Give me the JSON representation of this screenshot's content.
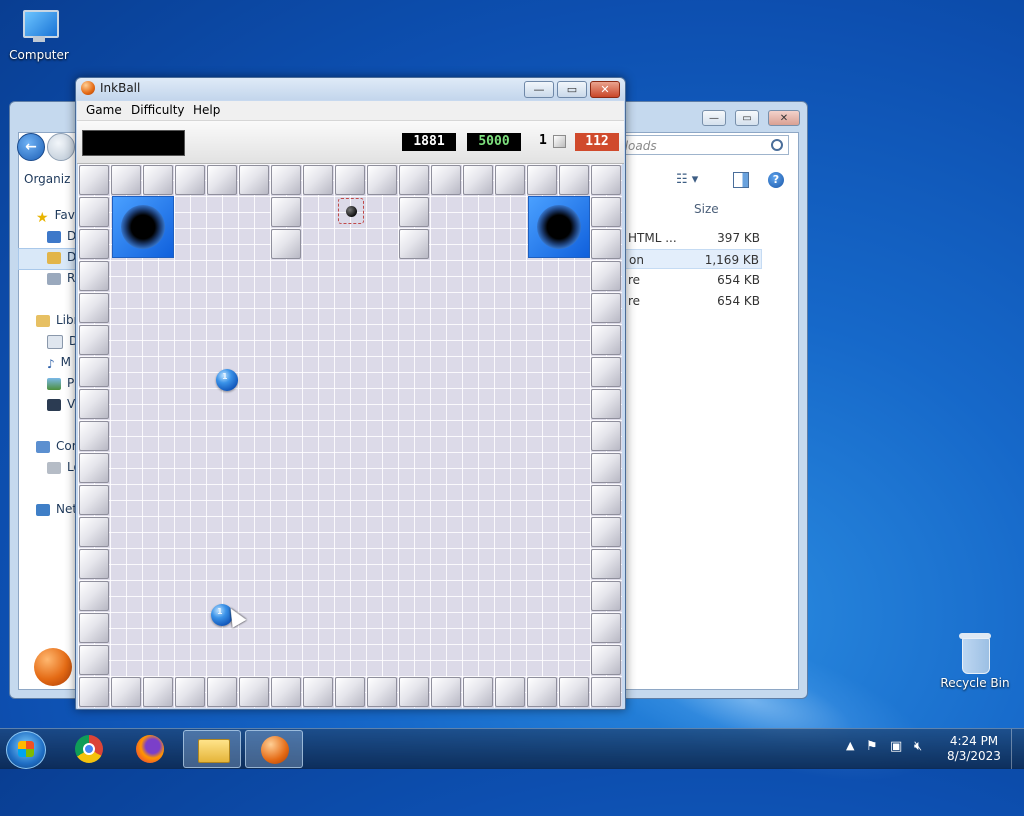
{
  "desktop": {
    "icons": [
      {
        "label": "Computer",
        "icon": "computer-icon"
      },
      {
        "label": "Recycle Bin",
        "icon": "recycle-bin-icon"
      }
    ]
  },
  "explorer": {
    "search_placeholder": "ynloads",
    "toolbar": {
      "organize": "Organiz"
    },
    "nav_tree": [
      {
        "label": "Fav",
        "icon": "favorites-star-icon"
      },
      {
        "label": "D",
        "icon": "desktop-icon"
      },
      {
        "label": "D",
        "icon": "downloads-folder-icon"
      },
      {
        "label": "R",
        "icon": "recent-places-icon"
      },
      {
        "label": "Libr",
        "icon": "libraries-icon"
      },
      {
        "label": "D",
        "icon": "documents-icon"
      },
      {
        "label": "M",
        "icon": "music-icon"
      },
      {
        "label": "P",
        "icon": "pictures-icon"
      },
      {
        "label": "V",
        "icon": "videos-icon"
      },
      {
        "label": "Cor",
        "icon": "computer-icon"
      },
      {
        "label": "Lo",
        "icon": "local-disk-icon"
      },
      {
        "label": "Net",
        "icon": "network-icon"
      }
    ],
    "column_header": "Size",
    "files": [
      {
        "type": "HTML ...",
        "size": "397 KB"
      },
      {
        "type": "on",
        "size": "1,169 KB"
      },
      {
        "type": "re",
        "size": "654 KB"
      },
      {
        "type": "re",
        "size": "654 KB"
      }
    ]
  },
  "inkball": {
    "title": "InkBall",
    "menu": [
      "Game",
      "Difficulty",
      "Help"
    ],
    "window_buttons": {
      "minimize": "—",
      "maximize": "▭",
      "close": "✕"
    },
    "score": "1881",
    "target": "5000",
    "level": "1",
    "timer": "112",
    "colors": {
      "score": "#ffffff",
      "target": "#7ee07e",
      "timer_bg": "#d04a2c",
      "ball": "#1f6ed8",
      "hole": "#2a7de0"
    },
    "balls": [
      {
        "label": "1"
      },
      {
        "label": "1"
      }
    ]
  },
  "taskbar": {
    "apps": [
      "start-orb",
      "chrome",
      "firefox",
      "file-explorer",
      "inkball"
    ],
    "time": "4:24 PM",
    "date": "8/3/2023",
    "tray_icons": [
      "show-hidden-icons-arrow",
      "action-center-flag-icon",
      "network-icon",
      "volume-muted-icon"
    ]
  }
}
